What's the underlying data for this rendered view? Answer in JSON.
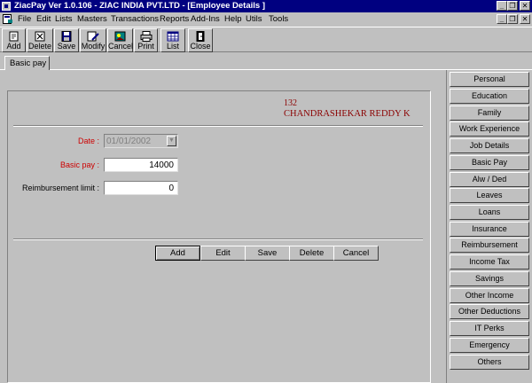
{
  "window": {
    "title": "ZiacPay Ver 1.0.106 - ZIAC INDIA PVT.LTD - [Employee Details ]"
  },
  "menu": [
    "File",
    "Edit",
    "Lists",
    "Masters",
    "Transactions",
    "Reports",
    "Add-Ins",
    "Help",
    "Utils",
    "Tools"
  ],
  "toolbar": [
    "Add",
    "Delete",
    "Save",
    "Modify",
    "Cancel",
    "Print",
    "List",
    "Close"
  ],
  "tab": {
    "label": "Basic pay"
  },
  "employee": {
    "id": "132",
    "name": "CHANDRASHEKAR REDDY K"
  },
  "form": {
    "date_label": "Date :",
    "date_value": "01/01/2002",
    "basic_label": "Basic pay :",
    "basic_value": "14000",
    "reimb_label": "Reimbursement limit :",
    "reimb_value": "0"
  },
  "actions": [
    "Add",
    "Edit",
    "Save",
    "Delete",
    "Cancel"
  ],
  "side_buttons": [
    "Personal",
    "Education",
    "Family",
    "Work Experience",
    "Job Details",
    "Basic Pay",
    "Alw / Ded",
    "Leaves",
    "Loans",
    "Insurance",
    "Reimbursement",
    "Income Tax",
    "Savings",
    "Other Income",
    "Other Deductions",
    "IT Perks",
    "Emergency",
    "Others"
  ],
  "colors": {
    "titlebar": "#000080",
    "label_red": "#cc0000",
    "header_text": "#8b0000",
    "face": "#c0c0c0"
  }
}
